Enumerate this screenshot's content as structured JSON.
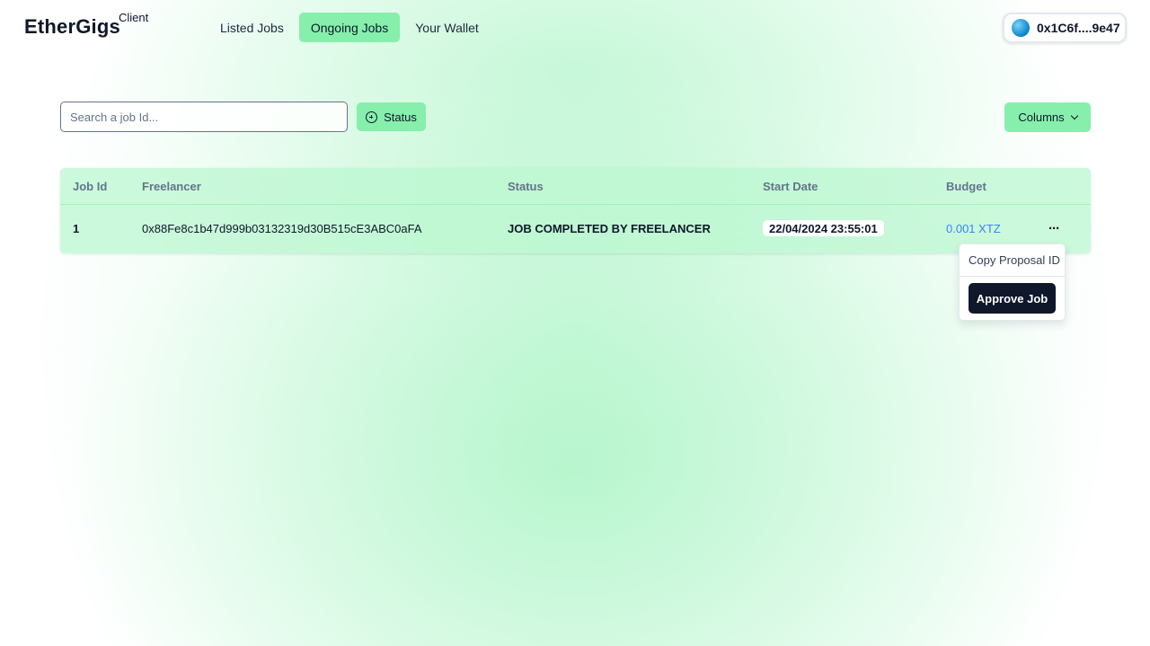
{
  "header": {
    "brand": "EtherGigs",
    "role": "Client",
    "nav": [
      {
        "label": "Listed Jobs",
        "active": false
      },
      {
        "label": "Ongoing Jobs",
        "active": true
      },
      {
        "label": "Your Wallet",
        "active": false
      }
    ],
    "wallet": {
      "address": "0x1C6f....9e47",
      "icon": "globe-icon"
    }
  },
  "toolbar": {
    "search_placeholder": "Search a job Id...",
    "search_value": "",
    "status_label": "Status",
    "status_icon": "plus-circle-icon",
    "columns_label": "Columns",
    "columns_icon": "chevron-down-icon"
  },
  "table": {
    "columns": [
      "Job Id",
      "Freelancer",
      "Status",
      "Start Date",
      "Budget"
    ],
    "rows": [
      {
        "job_id": "1",
        "freelancer": "0x88Fe8c1b47d999b03132319d30B515cE3ABC0aFA",
        "status": "JOB COMPLETED BY FREELANCER",
        "start_date": "22/04/2024 23:55:01",
        "budget": "0.001 XTZ",
        "actions_icon": "ellipsis-icon"
      }
    ]
  },
  "row_menu": {
    "copy_label": "Copy Proposal ID",
    "approve_label": "Approve Job"
  },
  "colors": {
    "accent": "#86efac",
    "table_bg": "#bbf7d0",
    "dark": "#0f172a",
    "link": "#3b82f6",
    "muted": "#64748b"
  }
}
